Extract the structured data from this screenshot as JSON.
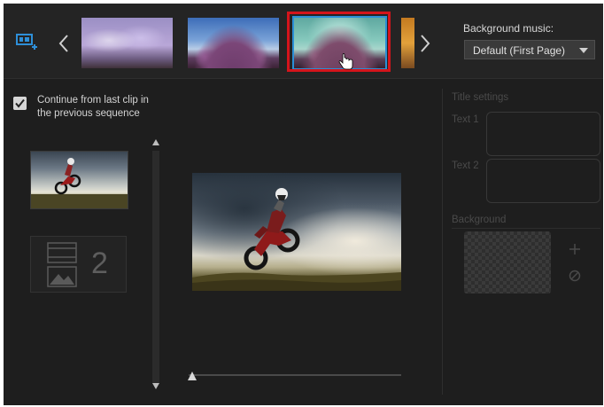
{
  "top": {
    "background_music_label": "Background music:",
    "background_music_value": "Default (First Page)"
  },
  "left": {
    "continue_label": "Continue from last clip in the previous sequence",
    "continue_checked": true,
    "clip2_number": "2"
  },
  "title_settings": {
    "heading": "Title settings",
    "text1_label": "Text 1",
    "text2_label": "Text 2",
    "background_label": "Background"
  },
  "colors": {
    "selected_border": "#2b8fd6",
    "highlight": "#d4141b"
  }
}
